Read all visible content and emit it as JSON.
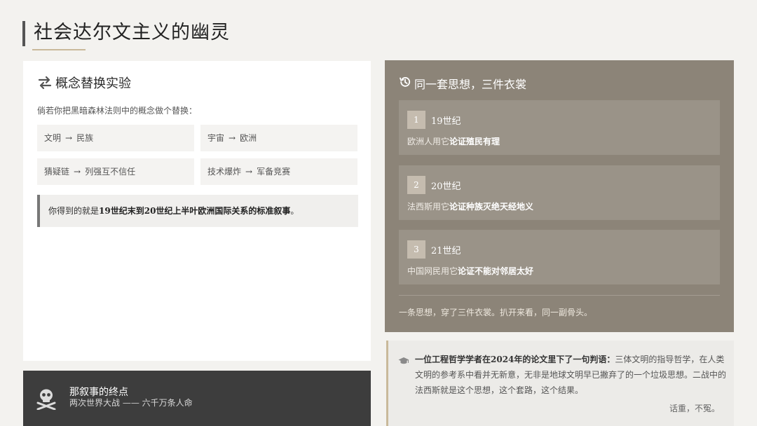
{
  "page": {
    "title": "社会达尔文主义的幽灵"
  },
  "experiment": {
    "icon": "swap-arrows-icon",
    "title": "概念替换实验",
    "intro": "倘若你把黑暗森林法则中的概念做个替换：",
    "pairs": [
      {
        "from": "文明",
        "to": "民族"
      },
      {
        "from": "宇宙",
        "to": "欧洲"
      },
      {
        "from": "猜疑链",
        "to": "列强互不信任"
      },
      {
        "from": "技术爆炸",
        "to": "军备竞赛"
      }
    ],
    "arrow": "→",
    "result_prefix": "你得到的就是",
    "result_bold": "19世纪末到20世纪上半叶欧洲国际关系的标准叙事",
    "result_suffix": "。"
  },
  "end_of_narrative": {
    "icon": "skull-crossbones-icon",
    "title": "那叙事的终点",
    "subtitle": "两次世界大战 —— 六千万条人命"
  },
  "three_outfits": {
    "icon": "history-clock-icon",
    "title": "同一套思想，三件衣裳",
    "eras": [
      {
        "num": "1",
        "century": "19世纪",
        "desc_prefix": "欧洲人用它",
        "desc_bold": "论证殖民有理"
      },
      {
        "num": "2",
        "century": "20世纪",
        "desc_prefix": "法西斯用它",
        "desc_bold": "论证种族灭绝天经地义"
      },
      {
        "num": "3",
        "century": "21世纪",
        "desc_prefix": "中国网民用它",
        "desc_bold": "论证不能对邻居太好"
      }
    ],
    "summary": "一条思想，穿了三件衣裳。扒开来看，同一副骨头。"
  },
  "quote": {
    "icon": "graduation-cap-icon",
    "lead_bold": "一位工程哲学学者在2024年的论文里下了一句判语：",
    "text": "三体文明的指导哲学，在人类文明的参考系中看并无新意，无非是地球文明早已撇弃了的一个垃圾思想。二战中的法西斯就是这个思想，这个套路，这个结果。",
    "sign": "话重，不冤。"
  }
}
